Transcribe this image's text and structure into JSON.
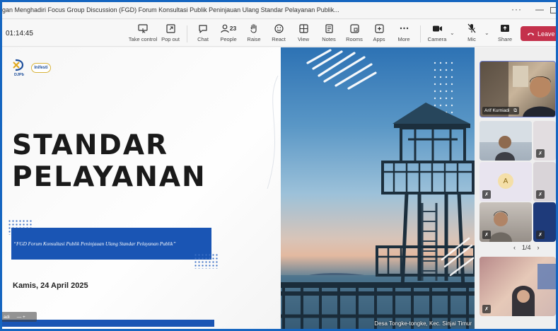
{
  "window": {
    "title": "gan Menghadiri Focus Group Discussion (FGD) Forum Konsultasi Publik Peninjauan Ulang Standar Pelayanan Publik...",
    "more_glyph": "···",
    "minimize_glyph": "—"
  },
  "toolbar": {
    "timer": "01:14:45",
    "take_control": "Take control",
    "pop_out": "Pop out",
    "chat": "Chat",
    "people": "People",
    "people_count": "23",
    "raise": "Raise",
    "react": "React",
    "view": "View",
    "notes": "Notes",
    "rooms": "Rooms",
    "apps": "Apps",
    "more": "More",
    "camera": "Camera",
    "mic": "Mic",
    "share": "Share",
    "leave": "Leave"
  },
  "slide": {
    "logo_left_text": "DJPb",
    "logo_right_text": "Inifesti",
    "title_line1": "STANDAR",
    "title_line2": "PELAYANAN",
    "banner_text": "“FGD Forum Konsultasi Publik Peninjauan Ulang Standar Pelayanan Publik”",
    "date": "Kamis, 24 April 2025",
    "presenter_tag": "adi",
    "presenter_tag_extra": "—  +"
  },
  "photo": {
    "caption": "Desa Tongke-tongke, Kec. Sinjai Timur"
  },
  "sidebar": {
    "main_participant": "Arif Kurniadi",
    "avatar_initial": "A",
    "page_indicator": "1/4",
    "prev_glyph": "‹",
    "next_glyph": "›"
  }
}
